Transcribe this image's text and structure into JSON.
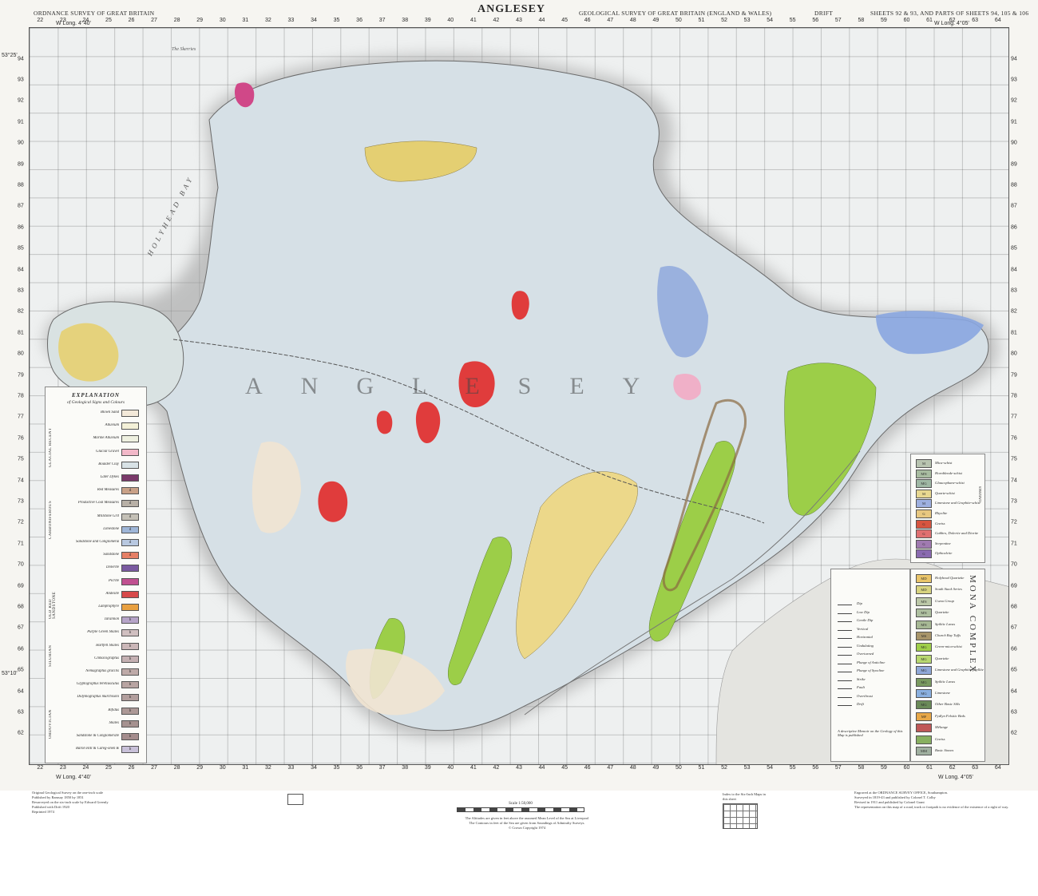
{
  "header": {
    "left": "ORDNANCE SURVEY OF GREAT BRITAIN",
    "title": "ANGLESEY",
    "center": "GEOLOGICAL SURVEY OF GREAT BRITAIN (ENGLAND & WALES)",
    "drift": "DRIFT",
    "right": "SHEETS 92 & 93, AND PARTS OF SHEETS 94, 105 & 106"
  },
  "grid": {
    "eastings": [
      "22",
      "23",
      "24",
      "25",
      "26",
      "27",
      "28",
      "29",
      "30",
      "31",
      "32",
      "33",
      "34",
      "35",
      "36",
      "37",
      "38",
      "39",
      "40",
      "41",
      "42",
      "43",
      "44",
      "45",
      "46",
      "47",
      "48",
      "49",
      "50",
      "51",
      "52",
      "53",
      "54",
      "55",
      "56",
      "57",
      "58",
      "59",
      "60",
      "61",
      "62",
      "63",
      "64"
    ],
    "northings": [
      "94",
      "93",
      "92",
      "91",
      "90",
      "89",
      "88",
      "87",
      "86",
      "85",
      "84",
      "83",
      "82",
      "81",
      "80",
      "79",
      "78",
      "77",
      "76",
      "75",
      "74",
      "73",
      "72",
      "71",
      "70",
      "69",
      "68",
      "67",
      "66",
      "65",
      "64",
      "63",
      "62"
    ],
    "long_left": "W Long. 4°40'",
    "long_right": "W Long. 4°05'",
    "long_right_bottom": "W Long. 4°05'",
    "long_left_bottom": "W Long. 4°40'",
    "lat_top": "53°25'",
    "lat_bottom": "53°10'"
  },
  "map": {
    "island_name": "ANGLESEY",
    "bay_left": "HOLYHEAD BAY",
    "place_north": "The Skerries"
  },
  "legend_left": {
    "title": "EXPLANATION",
    "subtitle": "of Geological Signs and Colours",
    "groups": [
      "GLACIAL RECENT",
      "CARBONIFEROUS",
      "OLD RED SANDSTONE",
      "SILURIAN",
      "ORDOVICIAN"
    ],
    "rows": [
      {
        "label": "Blown Sand",
        "color": "#f3e9d9",
        "code": ""
      },
      {
        "label": "Alluvium",
        "color": "#f4f1d8",
        "code": ""
      },
      {
        "label": "Marine Alluvium",
        "color": "#eef0e0",
        "code": ""
      },
      {
        "label": "Glacial Gravel",
        "color": "#f2b8c8",
        "code": ""
      },
      {
        "label": "Boulder Clay",
        "color": "#d8e2e6",
        "code": ""
      },
      {
        "label": "Later Dykes",
        "color": "#7a3a6a",
        "code": ""
      },
      {
        "label": "Red Measures",
        "color": "#c9a187",
        "code": "d"
      },
      {
        "label": "Productive Coal Measures",
        "color": "#b8b0a6",
        "code": "d"
      },
      {
        "label": "Millstone Grit",
        "color": "#c4c0b6",
        "code": "d"
      },
      {
        "label": "Limestone",
        "color": "#9fb6d8",
        "code": "d"
      },
      {
        "label": "Sandstone and Conglomerate",
        "color": "#b8c8e0",
        "code": "d"
      },
      {
        "label": "Sandstone",
        "color": "#e68066",
        "code": "d"
      },
      {
        "label": "Dolerite",
        "color": "#7a5aa0",
        "code": ""
      },
      {
        "label": "Picrite",
        "color": "#c05090",
        "code": ""
      },
      {
        "label": "Andesite",
        "color": "#d74a4a",
        "code": ""
      },
      {
        "label": "Lamprophyre",
        "color": "#e8a040",
        "code": ""
      },
      {
        "label": "Tarannon",
        "color": "#b6a4c8",
        "code": "b"
      },
      {
        "label": "Purple Green Shales",
        "color": "#d0bfc0",
        "code": "b"
      },
      {
        "label": "Hartfell Shales",
        "color": "#cbb7b8",
        "code": "b"
      },
      {
        "label": "Climacograptus",
        "color": "#c4b0b2",
        "code": "b"
      },
      {
        "label": "Nemagraptus gracilis",
        "color": "#beaaa8",
        "code": "b"
      },
      {
        "label": "Glyptograptus teretiusculus",
        "color": "#b8a4a2",
        "code": "b"
      },
      {
        "label": "Didymograptus murchisoni",
        "color": "#b29e9c",
        "code": "b"
      },
      {
        "label": "Bifidus",
        "color": "#ac9896",
        "code": "b"
      },
      {
        "label": "Shales",
        "color": "#a69290",
        "code": "b"
      },
      {
        "label": "Sandstone & Conglomerate",
        "color": "#a48c8c",
        "code": "b"
      },
      {
        "label": "Baron Hill & Careg-onen Rocks",
        "color": "#c8c0d8",
        "code": "b"
      }
    ]
  },
  "legend_right_top": {
    "rows": [
      {
        "code": "M",
        "label": "Mica-schist",
        "color": "#b8c4b0"
      },
      {
        "code": "MN",
        "label": "Hornblende-schist",
        "color": "#a8bca0"
      },
      {
        "code": "MG",
        "label": "Glaucophane-schist",
        "color": "#9fb8a4"
      },
      {
        "code": "M",
        "label": "Quartz-schist",
        "color": "#e8d890"
      },
      {
        "code": "M",
        "label": "Limestone and Graphite-schist",
        "color": "#9eb0e0"
      },
      {
        "code": "G",
        "label": "Rhyolite",
        "color": "#e8c880"
      },
      {
        "code": "G",
        "label": "Gneiss",
        "color": "#d7553f"
      },
      {
        "code": "G",
        "label": "Gabbro, Dolerite and Diorite",
        "color": "#e07070"
      },
      {
        "code": "G",
        "label": "Serpentine",
        "color": "#a07ab0"
      },
      {
        "code": "G",
        "label": "Ophicalcite",
        "color": "#8a6ab0"
      }
    ],
    "side_label": "GNEISSES"
  },
  "legend_right_bottom": {
    "rows": [
      {
        "code": "MD",
        "label": "Holyhead Quartzite",
        "color": "#eac56a"
      },
      {
        "code": "MD",
        "label": "South Stack Series",
        "color": "#d8d480"
      },
      {
        "code": "MN",
        "label": "Gwna Group",
        "color": "#bcc8a8"
      },
      {
        "code": "MN",
        "label": "Quartzite",
        "color": "#aec0a0"
      },
      {
        "code": "MN",
        "label": "Spilitic Lavas",
        "color": "#a6b894"
      },
      {
        "code": "MS",
        "label": "Church Bay Tuffs",
        "color": "#a8956a"
      },
      {
        "code": "MG",
        "label": "Green-mica-schist",
        "color": "#9fcf4a"
      },
      {
        "code": "MG",
        "label": "Quartzite",
        "color": "#b8d870"
      },
      {
        "code": "MG",
        "label": "Limestone and Graphitic phyllite",
        "color": "#90a8d8"
      },
      {
        "code": "MG",
        "label": "Spilitic Lavas",
        "color": "#7a9a60"
      },
      {
        "code": "MG",
        "label": "Limestone",
        "color": "#8ab0e0"
      },
      {
        "code": "MG",
        "label": "Other Basic Sills",
        "color": "#6a8a58"
      },
      {
        "code": "MF",
        "label": "Fydlyn Felsitic Beds",
        "color": "#e8a848"
      },
      {
        "code": "",
        "label": "Mélange",
        "color": "#c05858"
      },
      {
        "code": "",
        "label": "Gneiss",
        "color": "#88b060"
      },
      {
        "code": "MM",
        "label": "Basic Stones",
        "color": "#a0b0a0"
      }
    ],
    "group_label": "MONA COMPLEX"
  },
  "key_panel": {
    "rows": [
      "Dip",
      "Low Dip",
      "Gentle Dip",
      "Vertical",
      "Horizontal",
      "Undulating",
      "Overturned",
      "Plunge of Anticline",
      "Plunge of Syncline",
      "Strike",
      "Fault",
      "Overthrust",
      "Drift"
    ],
    "notes": [
      "A descriptive Memoir on the Geology of this Map is published"
    ]
  },
  "footer": {
    "scale_text": "Scale 1:50,000",
    "left_notes": [
      "Original Geological Survey on the one-inch scale",
      "Published by Ramsay 1850 by 1851",
      "Resurveyed on the six-inch scale by Edward Greenly",
      "Published with Drift 1920",
      "Reprinted 1974"
    ],
    "right_notes": [
      "Engraved at the ORDNANCE SURVEY OFFICE, Southampton.",
      "Surveyed in 1819-43 and published by Colonel T. Colby",
      "Revised in 1911 and published by Colonel Grant",
      "The representation on this map of a road, track or footpath is no evidence of the existence of a right of way."
    ],
    "center_notes": [
      "The Altitudes are given in feet above the assumed Mean Level of the Sea at Liverpool",
      "The Contours in feet of the Sea are given from Soundings of Admiralty Surveys.",
      "© Crown Copyright 1974"
    ],
    "index_label": "Index to the Six-Inch Maps in this sheet"
  },
  "colors": {
    "boulder_clay": "#d8e2e6",
    "granite": "#e04040",
    "green_schist": "#9fcf4a",
    "yellow_quartzite": "#ecd67a",
    "limestone_blue": "#8aa8e0",
    "sea": "#f6f6f4"
  }
}
